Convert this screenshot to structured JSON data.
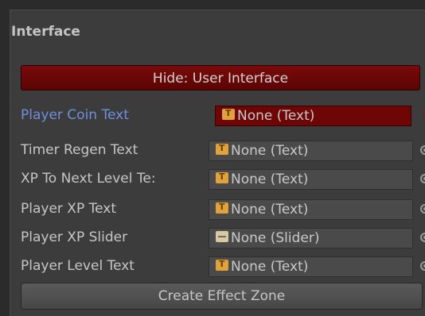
{
  "section": {
    "title": "Interface"
  },
  "hide_bar": {
    "label": "Hide: User Interface"
  },
  "fields": [
    {
      "label": "Player Coin Text",
      "value": "None (Text)",
      "icon": "text-icon",
      "highlight": true
    },
    {
      "label": "Timer Regen Text",
      "value": "None (Text)",
      "icon": "text-icon"
    },
    {
      "label": "XP To Next Level Te:",
      "value": "None (Text)",
      "icon": "text-icon"
    },
    {
      "label": "Player XP Text",
      "value": "None (Text)",
      "icon": "text-icon"
    },
    {
      "label": "Player XP Slider",
      "value": "None (Slider)",
      "icon": "slider-icon"
    },
    {
      "label": "Player Level Text",
      "value": "None (Text)",
      "icon": "text-icon"
    }
  ],
  "create_button": {
    "label": "Create Effect Zone"
  },
  "colors": {
    "panel": "#3c3c3c",
    "hide_bar": "#6e0606",
    "highlight_label": "#6f8fdc",
    "icon": "#e0a23a"
  }
}
